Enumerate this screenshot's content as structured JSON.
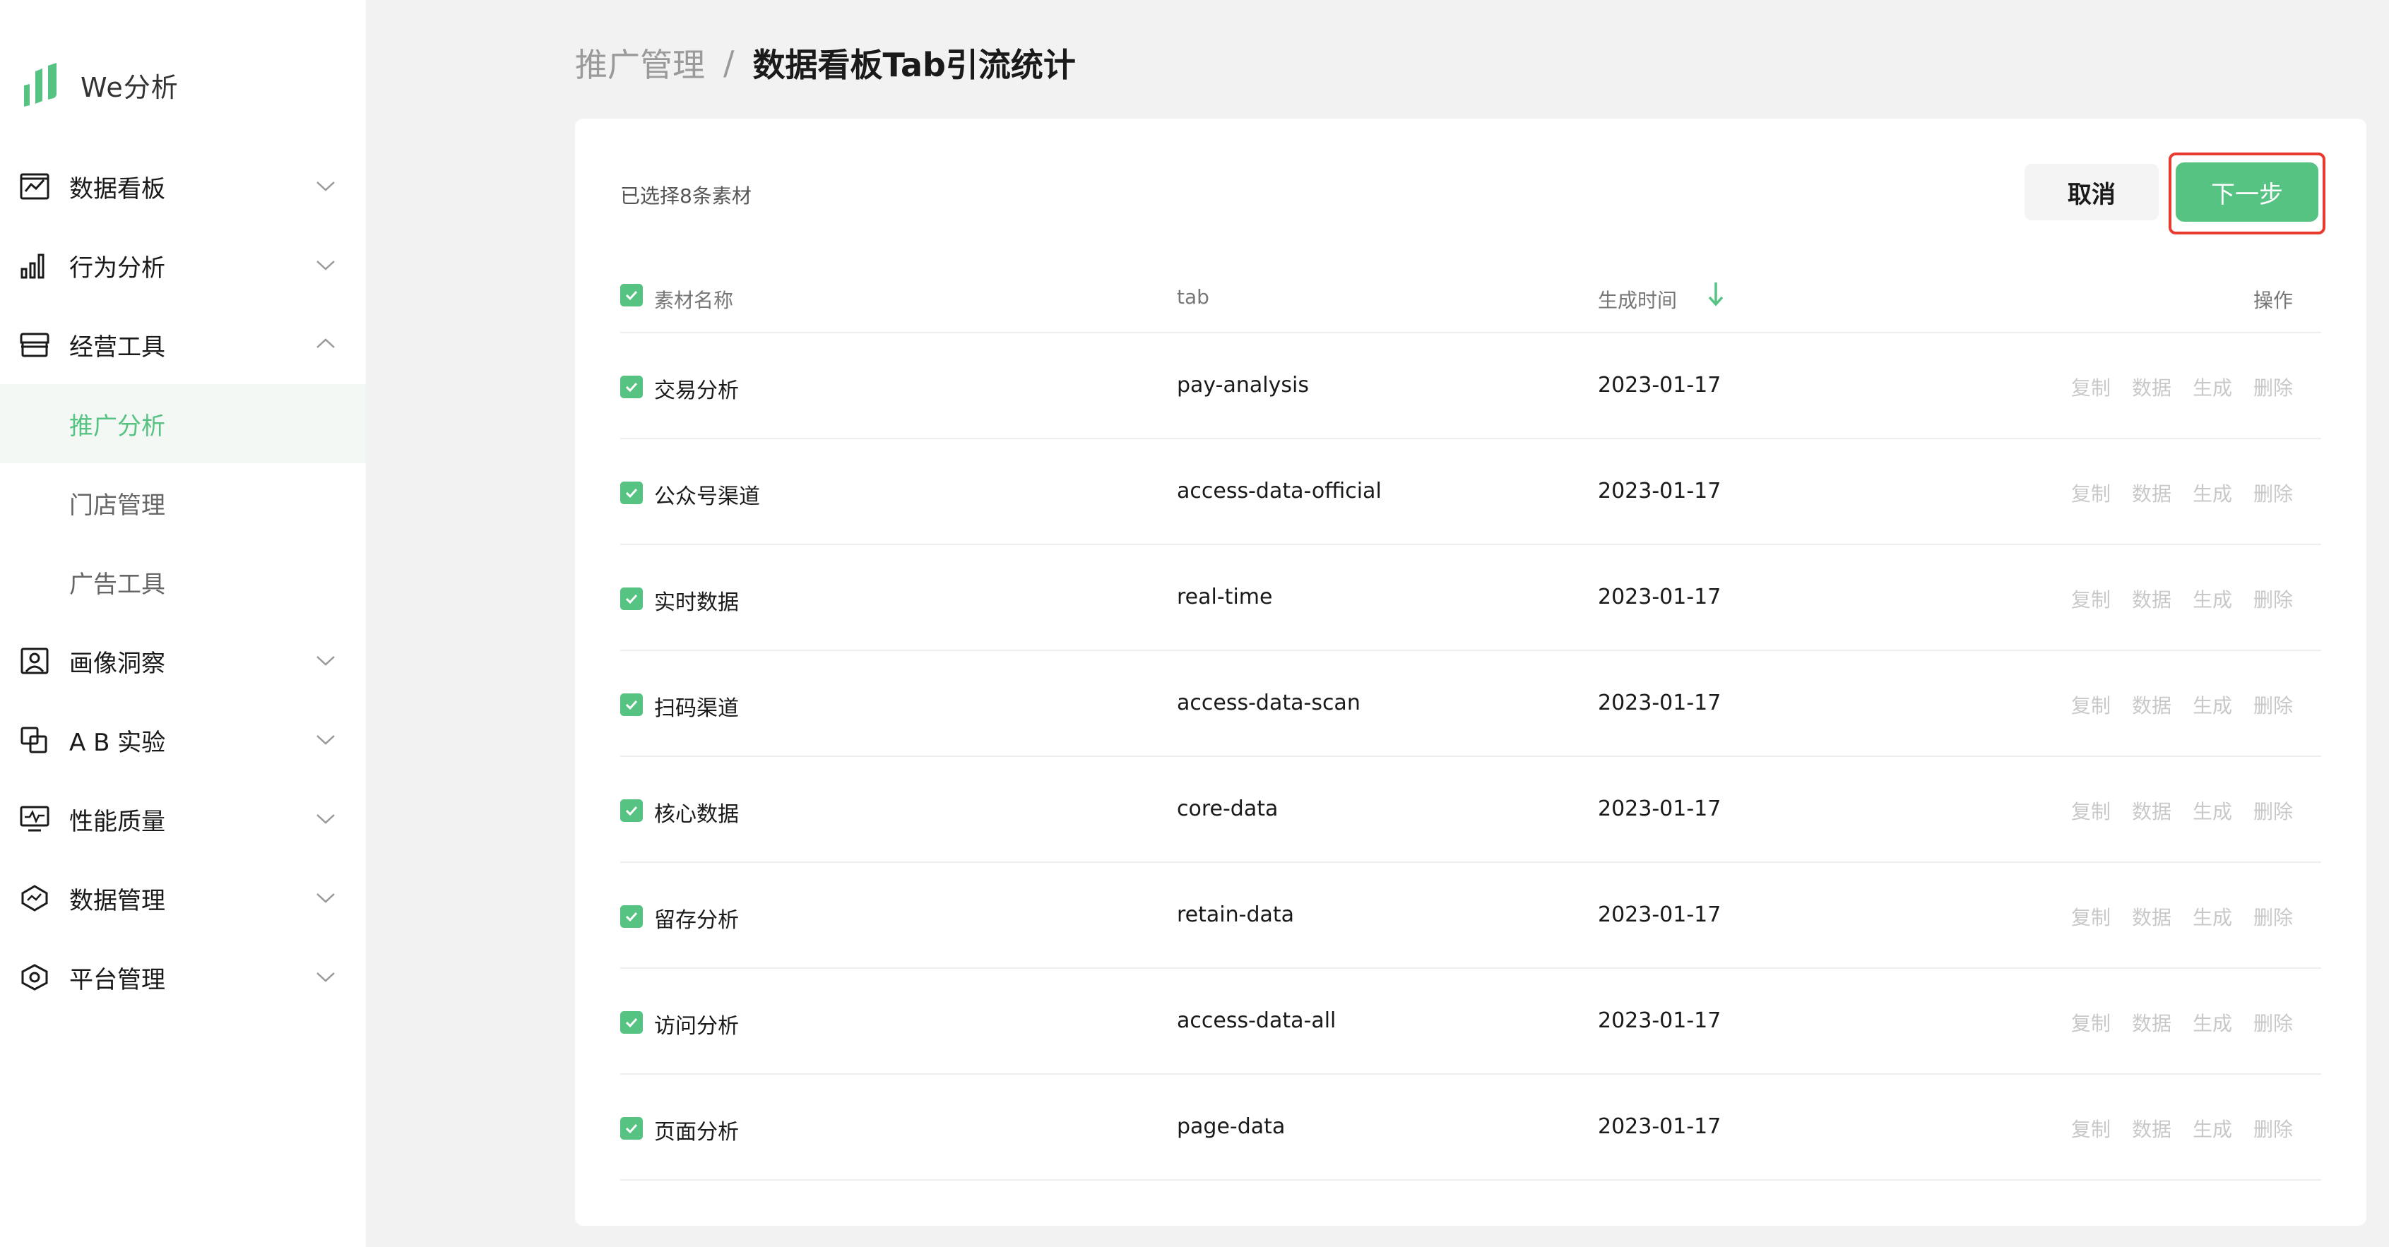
{
  "app": {
    "name": "We分析"
  },
  "nav": {
    "items": [
      {
        "label": "数据看板",
        "icon": "dashboard-chart-icon",
        "expanded": false
      },
      {
        "label": "行为分析",
        "icon": "bar-chart-icon",
        "expanded": false
      },
      {
        "label": "经营工具",
        "icon": "store-icon",
        "expanded": true
      },
      {
        "label": "画像洞察",
        "icon": "portrait-icon",
        "expanded": false
      },
      {
        "label": "A B 实验",
        "icon": "ab-test-icon",
        "expanded": false
      },
      {
        "label": "性能质量",
        "icon": "monitor-icon",
        "expanded": false
      },
      {
        "label": "数据管理",
        "icon": "data-shield-icon",
        "expanded": false
      },
      {
        "label": "平台管理",
        "icon": "hexagon-settings-icon",
        "expanded": false
      }
    ],
    "subitems": [
      {
        "label": "推广分析",
        "active": true
      },
      {
        "label": "门店管理",
        "active": false
      },
      {
        "label": "广告工具",
        "active": false
      }
    ]
  },
  "breadcrumb": {
    "parent": "推广管理",
    "separator": "/",
    "current": "数据看板Tab引流统计"
  },
  "toolbar": {
    "selected_text": "已选择8条素材",
    "cancel_label": "取消",
    "next_label": "下一步"
  },
  "table": {
    "headers": {
      "name": "素材名称",
      "tab": "tab",
      "time": "生成时间",
      "ops": "操作"
    },
    "op_labels": [
      "复制",
      "数据",
      "生成",
      "删除"
    ],
    "rows": [
      {
        "name": "交易分析",
        "tab": "pay-analysis",
        "time": "2023-01-17"
      },
      {
        "name": "公众号渠道",
        "tab": "access-data-official",
        "time": "2023-01-17"
      },
      {
        "name": "实时数据",
        "tab": "real-time",
        "time": "2023-01-17"
      },
      {
        "name": "扫码渠道",
        "tab": "access-data-scan",
        "time": "2023-01-17"
      },
      {
        "name": "核心数据",
        "tab": "core-data",
        "time": "2023-01-17"
      },
      {
        "name": "留存分析",
        "tab": "retain-data",
        "time": "2023-01-17"
      },
      {
        "name": "访问分析",
        "tab": "access-data-all",
        "time": "2023-01-17"
      },
      {
        "name": "页面分析",
        "tab": "page-data",
        "time": "2023-01-17"
      }
    ]
  },
  "colors": {
    "accent": "#56c383",
    "highlight_frame": "#e83a2f",
    "disabled_op": "#c8c8c8"
  }
}
